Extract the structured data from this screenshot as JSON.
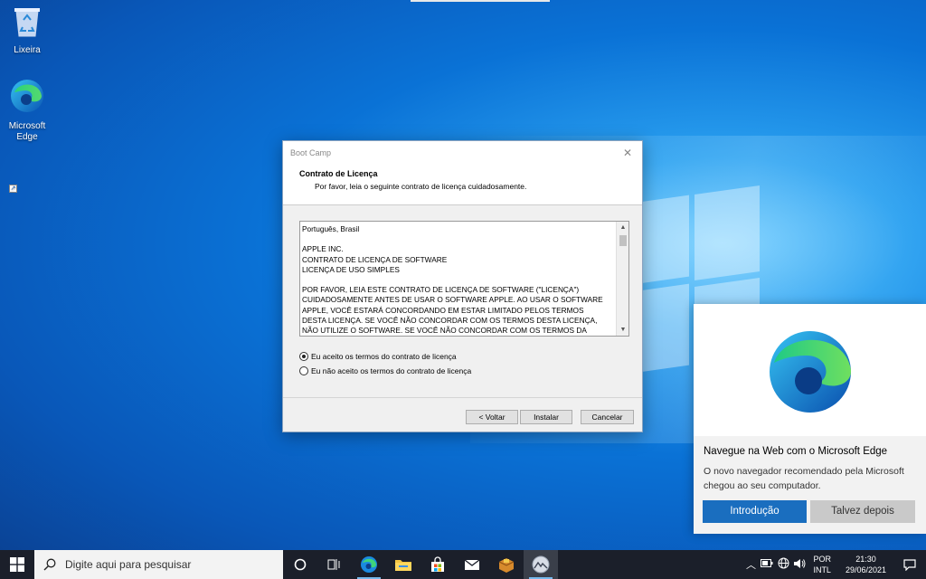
{
  "desktop": {
    "icons": [
      {
        "label": "Lixeira",
        "icon": "recycle-bin-icon"
      },
      {
        "label": "Microsoft Edge",
        "icon": "edge-icon"
      }
    ]
  },
  "dialog": {
    "title": "Boot Camp",
    "close_glyph": "✕",
    "header_title": "Contrato de Licença",
    "header_subtitle": "Por favor, leia o seguinte contrato de licença cuidadosamente.",
    "license_text": "Português, Brasil\n\nAPPLE INC.\nCONTRATO DE LICENÇA DE SOFTWARE\nLICENÇA DE USO SIMPLES\n\nPOR FAVOR, LEIA ESTE CONTRATO DE LICENÇA DE SOFTWARE (\"LICENÇA\")\nCUIDADOSAMENTE ANTES DE USAR O SOFTWARE APPLE. AO USAR O SOFTWARE\nAPPLE, VOCÊ ESTARÁ CONCORDANDO EM ESTAR LIMITADO PELOS TERMOS\nDESTA LICENÇA. SE VOCÊ NÃO CONCORDAR COM OS TERMOS DESTA LICENÇA,\nNÃO UTILIZE O SOFTWARE. SE VOCÊ NÃO CONCORDAR COM OS TERMOS DA",
    "scroll_up_glyph": "▲",
    "scroll_down_glyph": "▼",
    "radio_accept": "Eu aceito os termos do contrato de licença",
    "radio_decline": "Eu não aceito os termos do contrato de licença",
    "selected_option": "accept",
    "buttons": {
      "back": "< Voltar",
      "install": "Instalar",
      "cancel": "Cancelar"
    }
  },
  "toast": {
    "title": "Navegue na Web com o Microsoft  Edge",
    "body": "O novo navegador recomendado pela Microsoft chegou ao seu computador.",
    "primary_button": "Introdução",
    "secondary_button": "Talvez depois"
  },
  "taskbar": {
    "search_placeholder": "Digite aqui para pesquisar",
    "apps": [
      "cortana-icon",
      "task-view-icon",
      "edge-icon",
      "file-explorer-icon",
      "store-icon",
      "mail-icon",
      "package-icon",
      "bootcamp-icon"
    ],
    "tray": {
      "lang_line1": "POR",
      "lang_line2": "INTL",
      "time": "21:30",
      "date": "29/06/2021",
      "up_glyph": "︿"
    }
  },
  "colors": {
    "accent": "#1a6ebf",
    "taskbar_bg": "#1b1f2a",
    "desktop_blue": "#0a72d6"
  }
}
